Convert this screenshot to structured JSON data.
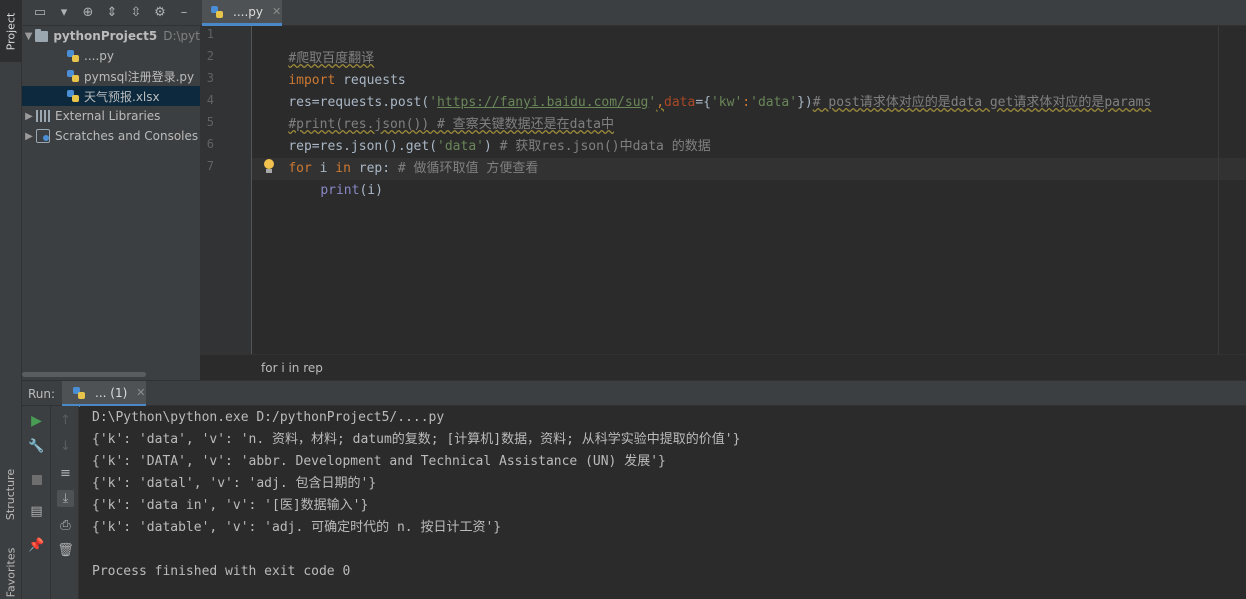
{
  "sidebar_tabs": {
    "project": "Project",
    "structure": "Structure",
    "favorites": "Favorites"
  },
  "toolbar": {
    "icons": [
      "layout-icon",
      "dropdown-icon",
      "locate-icon",
      "expand-all-icon",
      "collapse-all-icon",
      "gear-icon",
      "minimize-icon"
    ]
  },
  "project_tree": {
    "root_label": "pythonProject5",
    "root_path": "D:\\pyt",
    "files": [
      {
        "label": "....py"
      },
      {
        "label": "pymsql注册登录.py"
      },
      {
        "label": "天气预报.xlsx"
      }
    ],
    "external_libraries": "External Libraries",
    "scratches": "Scratches and Consoles"
  },
  "editor_tab": {
    "label": "....py"
  },
  "line_numbers": [
    "1",
    "2",
    "3",
    "4",
    "5",
    "6",
    "7"
  ],
  "code": {
    "l1": "#爬取百度翻译",
    "l2_kw": "import",
    "l2_rest": " requests",
    "l3_a": "res=requests.post(",
    "l3_q1": "'",
    "l3_url": "https://fanyi.baidu.com/sug",
    "l3_q2": "'",
    "l3_comma": ",",
    "l3_param": "data",
    "l3_eq": "={",
    "l3_k": "'kw'",
    "l3_colon": ":",
    "l3_v": "'data'",
    "l3_close": "})",
    "l3_comment": "# post请求体对应的是data get请求体对应的是params",
    "l4": "#print(res.json()) # 查察关键数据还是在data中",
    "l5_a": "rep=res.json().get(",
    "l5_str": "'data'",
    "l5_b": ") ",
    "l5_comment": "# 获取res.json()中data 的数据",
    "l6_for": "for",
    "l6_i": " i ",
    "l6_in": "in",
    "l6_rep": " rep: ",
    "l6_comment": "# 做循环取值 方便查看",
    "l7_print": "print",
    "l7_args": "(i)"
  },
  "breadcrumb": "for i in rep",
  "run": {
    "label": "Run:",
    "tab_label": "... (1)",
    "output": [
      "D:\\Python\\python.exe D:/pythonProject5/....py",
      "{'k': 'data', 'v': 'n. 资料，材料; datum的复数; [计算机]数据，资料; 从科学实验中提取的价值'}",
      "{'k': 'DATA', 'v': 'abbr. Development and Technical Assistance (UN) 发展'}",
      "{'k': 'datal', 'v': 'adj. 包含日期的'}",
      "{'k': 'data in', 'v': '[医]数据输入'}",
      "{'k': 'datable', 'v': 'adj. 可确定时代的 n. 按日计工资'}",
      "",
      "Process finished with exit code 0"
    ]
  },
  "colors": {
    "background": "#2b2b2b",
    "panel": "#3c3f41",
    "selection": "#0d293e",
    "keyword": "#cc7832",
    "string": "#6a8759",
    "comment": "#808080",
    "accent": "#4a88c7"
  }
}
